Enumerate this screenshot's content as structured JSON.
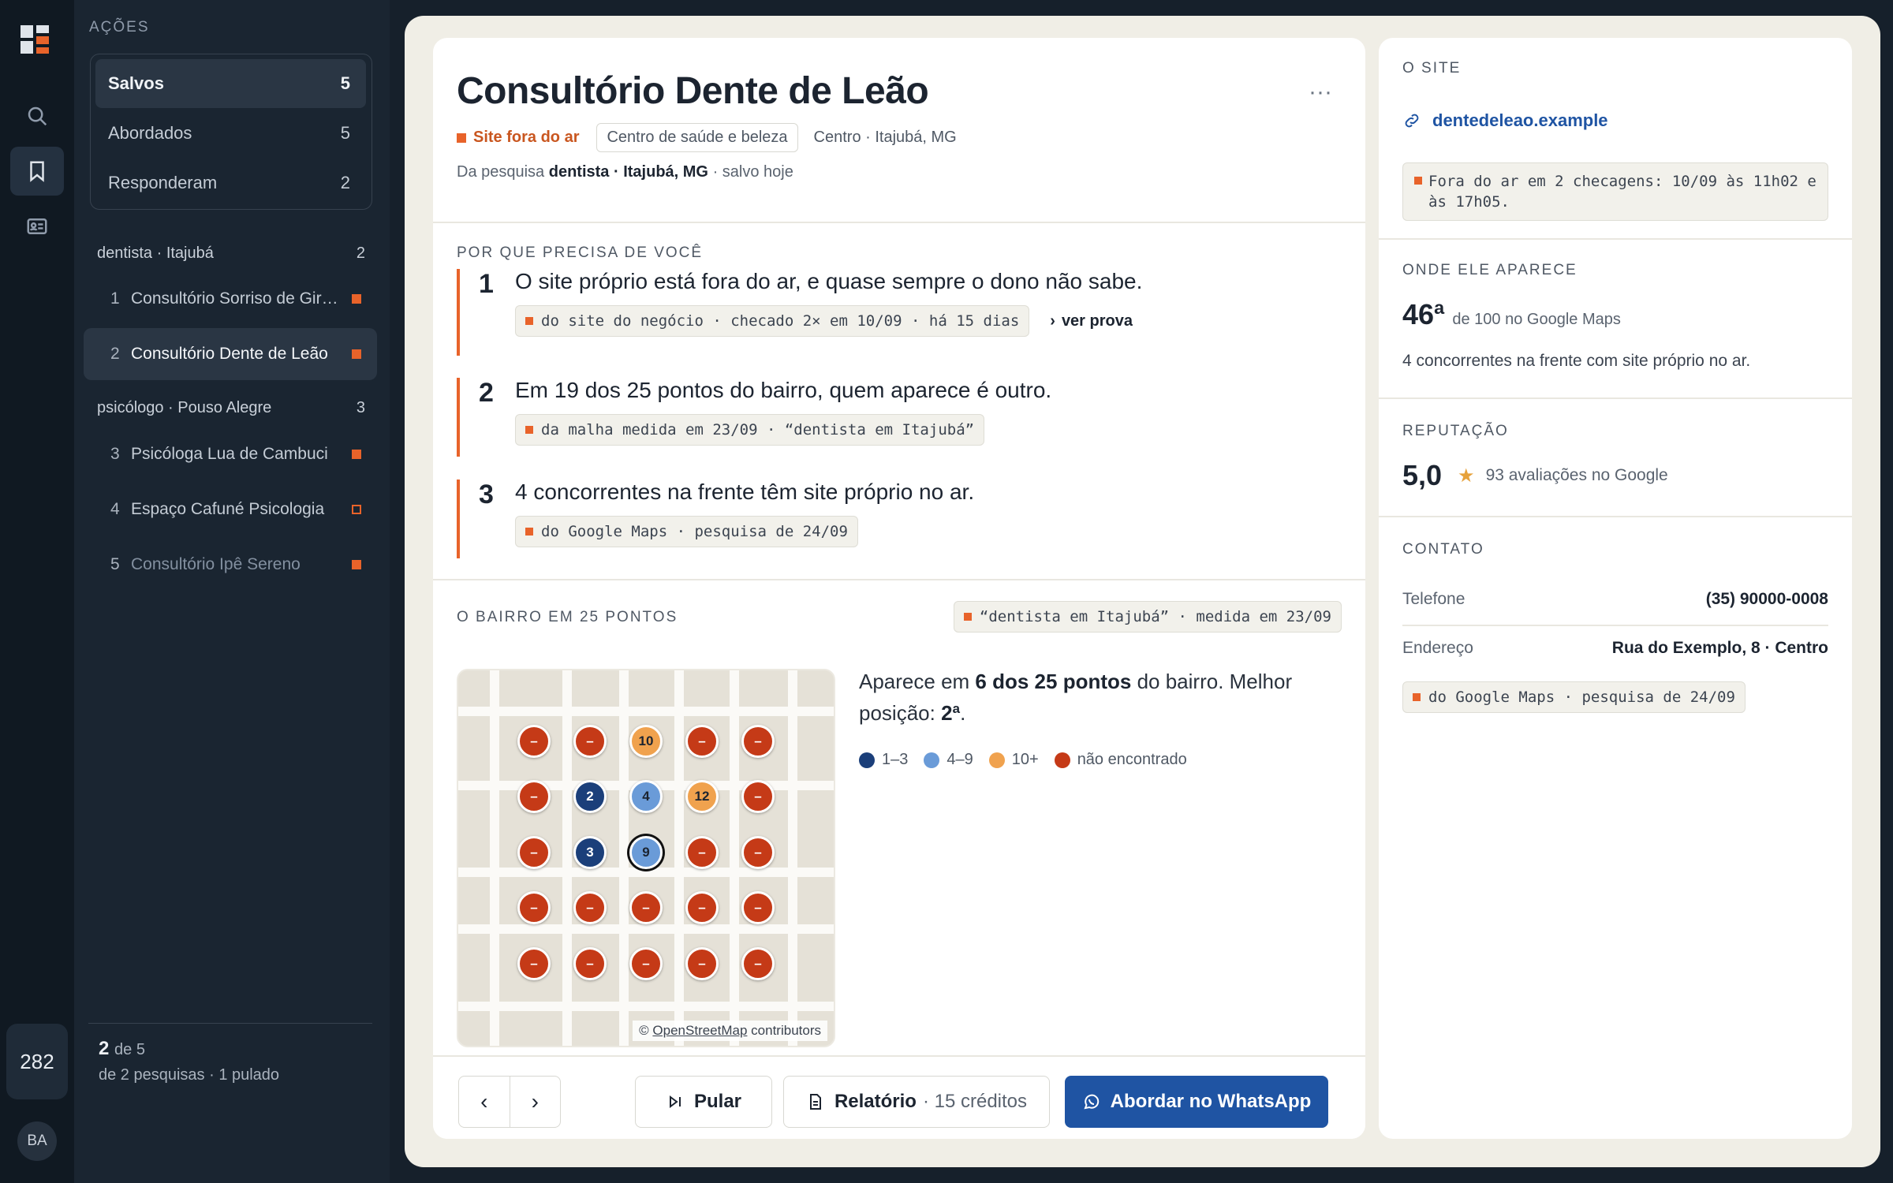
{
  "app": {
    "count": "282",
    "avatar": "BA",
    "icons": [
      "logo-icon",
      "search-icon",
      "bookmark-icon",
      "id-card-icon"
    ]
  },
  "sidebar": {
    "section": "AÇÕES",
    "items": [
      {
        "label": "Salvos",
        "count": "5"
      },
      {
        "label": "Abordados",
        "count": "5"
      },
      {
        "label": "Responderam",
        "count": "2"
      }
    ],
    "groups": [
      {
        "label": "dentista · Itajubá",
        "count": "2",
        "leads": [
          {
            "n": "1",
            "name": "Consultório Sorriso de Girassol"
          },
          {
            "n": "2",
            "name": "Consultório Dente de Leão"
          }
        ]
      },
      {
        "label": "psicólogo · Pouso Alegre",
        "count": "3",
        "leads": [
          {
            "n": "3",
            "name": "Psicóloga Lua de Cambuci"
          },
          {
            "n": "4",
            "name": "Espaço Cafuné Psicologia"
          },
          {
            "n": "5",
            "name": "Consultório Ipê Sereno"
          }
        ]
      }
    ],
    "footer": {
      "pos": "2",
      "of": "de 5",
      "sub": "de 2 pesquisas · 1 pulado"
    }
  },
  "lead": {
    "title": "Consultório Dente de Leão",
    "more": "···",
    "status": "Site fora do ar",
    "category": "Centro de saúde e beleza",
    "location": "Centro · Itajubá, MG",
    "from_prefix": "Da pesquisa",
    "from_query": "dentista · Itajubá, MG",
    "from_suffix": "· salvo hoje"
  },
  "why": {
    "heading": "POR QUE PRECISA DE VOCÊ",
    "reasons": [
      {
        "n": "1",
        "text": "O site próprio está fora do ar, e quase sempre o dono não sabe.",
        "evidence": "do site do negócio · checado 2× em 10/09 · há 15 dias",
        "proof": "ver prova"
      },
      {
        "n": "2",
        "text": "Em 19 dos 25 pontos do bairro, quem aparece é outro.",
        "evidence": "da malha medida em 23/09 · “dentista em Itajubá”"
      },
      {
        "n": "3",
        "text": "4 concorrentes na frente têm site próprio no ar.",
        "evidence": "do Google Maps · pesquisa de 24/09"
      }
    ]
  },
  "grid": {
    "heading": "O BAIRRO EM 25 PONTOS",
    "source": "“dentista em Itajubá” · medida em 23/09",
    "summary_a": "Aparece em",
    "summary_b": "6 dos 25 pontos",
    "summary_c": "do bairro. Melhor posição:",
    "summary_d": "2ª",
    "summary_e": ".",
    "legend": [
      "1–3",
      "4–9",
      "10+",
      "não encontrado"
    ],
    "legend_colors": [
      "#1b3f7a",
      "#6a9bd8",
      "#f0a24e",
      "#c53a17"
    ],
    "attrib_a": "©",
    "attrib_link": "OpenStreetMap",
    "attrib_b": "contributors",
    "cells": [
      "–",
      "–",
      "10",
      "–",
      "–",
      "–",
      "2",
      "4",
      "12",
      "–",
      "–",
      "3",
      "9",
      "–",
      "–",
      "–",
      "–",
      "–",
      "–",
      "–",
      "–",
      "–",
      "–",
      "–",
      "–"
    ],
    "center_index": 12
  },
  "actions": {
    "skip": "Pular",
    "report": "Relatório",
    "report_cost": "· 15 créditos",
    "whatsapp": "Abordar no WhatsApp"
  },
  "panel": {
    "site_h": "O SITE",
    "site_link": "dentedeleao.example",
    "site_note": "Fora do ar em 2 checagens: 10/09 às 11h02 e às 17h05.",
    "appear_h": "ONDE ELE APARECE",
    "rank": "46ª",
    "rank_sub": "de 100 no Google Maps",
    "competitors": "4 concorrentes na frente com site próprio no ar.",
    "rep_h": "REPUTAÇÃO",
    "rating": "5,0",
    "reviews": "93 avaliações no Google",
    "contact_h": "CONTATO",
    "phone_l": "Telefone",
    "phone": "(35) 90000-0008",
    "addr_l": "Endereço",
    "addr": "Rua do Exemplo, 8 · Centro",
    "addr_src": "do Google Maps · pesquisa de 24/09"
  }
}
